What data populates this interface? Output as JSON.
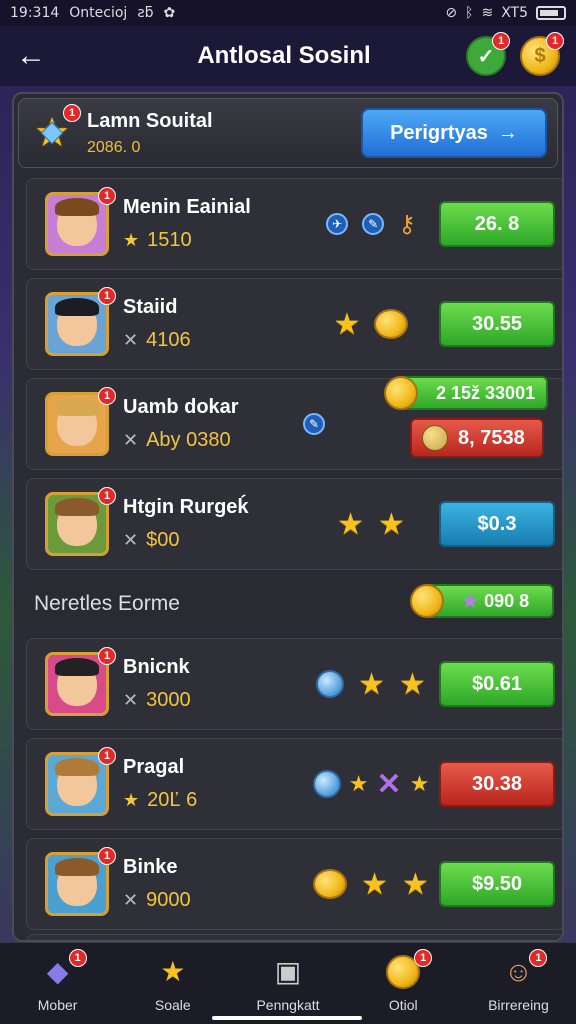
{
  "status_bar": {
    "time": "19:314",
    "carrier": "Ontecioj",
    "extra": "ƨƃ",
    "signal_text": "XT5"
  },
  "topbar": {
    "title": "Antlosal Sosinl",
    "check_badge": "1",
    "coin_badge": "1"
  },
  "header": {
    "name": "Lamn Souital",
    "sub": "2086. 0",
    "badge": "1",
    "button_label": "Perigrtyas",
    "button_arrow": "→"
  },
  "rows": [
    {
      "name": "Menin Eainial",
      "stat": "1510",
      "stat_icon": "star",
      "value": "26. 8",
      "value_color": "green",
      "badge": "1"
    },
    {
      "name": "Staiid",
      "stat": "4106",
      "stat_icon": "x",
      "value": "30.55",
      "value_color": "green",
      "badge": "1"
    },
    {
      "name": "Uamb dokar",
      "stat": "Aby 0380",
      "stat_icon": "x",
      "pill_value": "2 15ž 33001",
      "red_value": "8, 7538",
      "badge": "1"
    },
    {
      "name": "Htgin Rurgeḱ",
      "stat": "$00",
      "stat_icon": "x",
      "value": "$0.3",
      "value_color": "blue",
      "badge": "1"
    }
  ],
  "section": {
    "label": "Neretles Eorme",
    "pill_value": "090 8"
  },
  "rows2": [
    {
      "name": "Bnicnk",
      "stat": "3000",
      "stat_icon": "x",
      "value": "$0.61",
      "value_color": "green",
      "badge": "1"
    },
    {
      "name": "Pragal",
      "stat": "20Ľ 6",
      "stat_icon": "star",
      "value": "30.38",
      "value_color": "red",
      "badge": "1"
    },
    {
      "name": "Binke",
      "stat": "9000",
      "stat_icon": "x",
      "value": "$9.50",
      "value_color": "green",
      "badge": "1"
    }
  ],
  "nav": [
    {
      "label": "Mober",
      "icon": "gem-icon",
      "badge": "1"
    },
    {
      "label": "Soale",
      "icon": "star-icon",
      "badge": ""
    },
    {
      "label": "Penngkatt",
      "icon": "chat-icon",
      "badge": ""
    },
    {
      "label": "Otiol",
      "icon": "coin-icon",
      "badge": "1"
    },
    {
      "label": "Birrereing",
      "icon": "person-icon",
      "badge": "1"
    }
  ]
}
